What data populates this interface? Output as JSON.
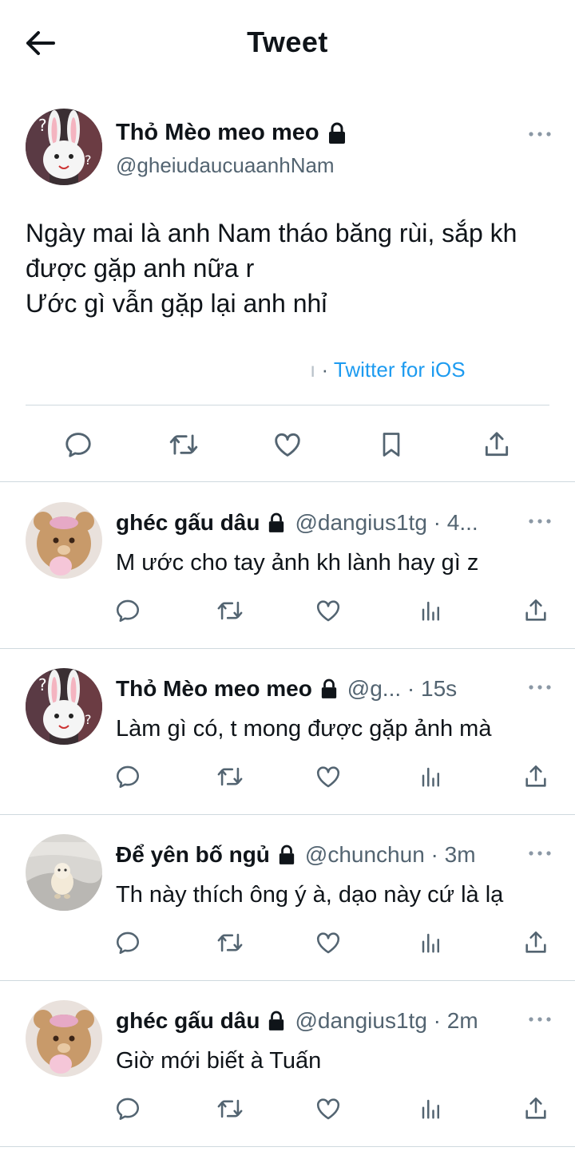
{
  "header": {
    "title": "Tweet",
    "back_icon": "arrow-left-icon"
  },
  "main_tweet": {
    "name": "Thỏ Mèo meo meo",
    "handle": "@gheiudaucuaanhNam",
    "text_lines": [
      "Ngày mai là anh Nam tháo băng rùi, sắp kh",
      "được gặp anh nữa r",
      "Ước gì vẫn gặp lại anh nhỉ"
    ],
    "meta_faded": "ı",
    "meta_separator": "·",
    "source": "Twitter for iOS",
    "actions": [
      "reply-icon",
      "retweet-icon",
      "like-icon",
      "bookmark-icon",
      "share-icon"
    ]
  },
  "replies": [
    {
      "name": "ghéc gấu dâu",
      "handle": "@dangius1tg · 4...",
      "text": "M ước cho tay ảnh kh lành hay gì z"
    },
    {
      "name": "Thỏ Mèo meo meo",
      "handle": "@g... · 15s",
      "text": "Làm gì có, t mong được gặp ảnh mà"
    },
    {
      "name": "Để yên bố ngủ",
      "handle": "@chunchun · 3m",
      "text": "Th này thích ông ý à, dạo này cứ là lạ"
    },
    {
      "name": "ghéc gấu dâu",
      "handle": "@dangius1tg · 2m",
      "text": "Giờ mới biết à Tuấn"
    }
  ],
  "colors": {
    "text": "#0f1419",
    "secondary": "#536471",
    "link": "#1d9bf0",
    "divider": "#cfd9de"
  }
}
